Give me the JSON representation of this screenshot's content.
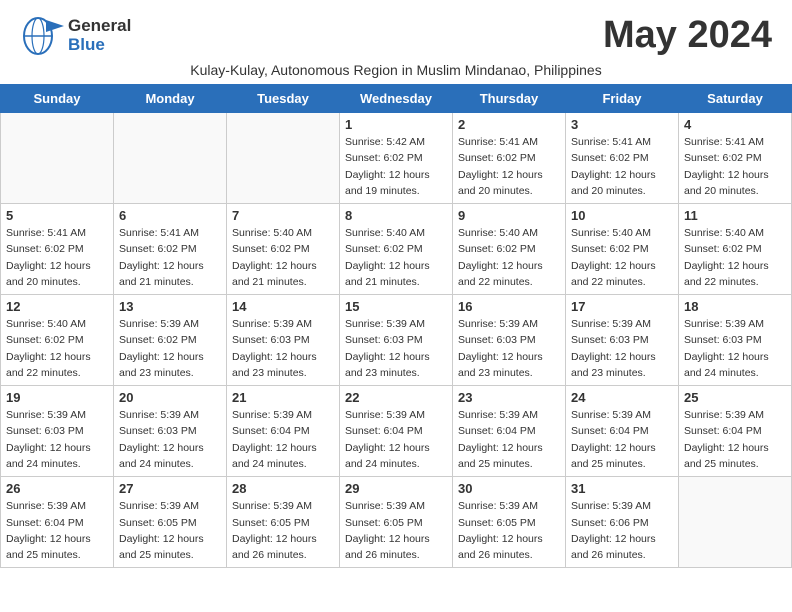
{
  "logo": {
    "general": "General",
    "blue": "Blue"
  },
  "title": "May 2024",
  "subtitle": "Kulay-Kulay, Autonomous Region in Muslim Mindanao, Philippines",
  "days": [
    "Sunday",
    "Monday",
    "Tuesday",
    "Wednesday",
    "Thursday",
    "Friday",
    "Saturday"
  ],
  "weeks": [
    [
      {
        "num": "",
        "info": ""
      },
      {
        "num": "",
        "info": ""
      },
      {
        "num": "",
        "info": ""
      },
      {
        "num": "1",
        "info": "Sunrise: 5:42 AM\nSunset: 6:02 PM\nDaylight: 12 hours\nand 19 minutes."
      },
      {
        "num": "2",
        "info": "Sunrise: 5:41 AM\nSunset: 6:02 PM\nDaylight: 12 hours\nand 20 minutes."
      },
      {
        "num": "3",
        "info": "Sunrise: 5:41 AM\nSunset: 6:02 PM\nDaylight: 12 hours\nand 20 minutes."
      },
      {
        "num": "4",
        "info": "Sunrise: 5:41 AM\nSunset: 6:02 PM\nDaylight: 12 hours\nand 20 minutes."
      }
    ],
    [
      {
        "num": "5",
        "info": "Sunrise: 5:41 AM\nSunset: 6:02 PM\nDaylight: 12 hours\nand 20 minutes."
      },
      {
        "num": "6",
        "info": "Sunrise: 5:41 AM\nSunset: 6:02 PM\nDaylight: 12 hours\nand 21 minutes."
      },
      {
        "num": "7",
        "info": "Sunrise: 5:40 AM\nSunset: 6:02 PM\nDaylight: 12 hours\nand 21 minutes."
      },
      {
        "num": "8",
        "info": "Sunrise: 5:40 AM\nSunset: 6:02 PM\nDaylight: 12 hours\nand 21 minutes."
      },
      {
        "num": "9",
        "info": "Sunrise: 5:40 AM\nSunset: 6:02 PM\nDaylight: 12 hours\nand 22 minutes."
      },
      {
        "num": "10",
        "info": "Sunrise: 5:40 AM\nSunset: 6:02 PM\nDaylight: 12 hours\nand 22 minutes."
      },
      {
        "num": "11",
        "info": "Sunrise: 5:40 AM\nSunset: 6:02 PM\nDaylight: 12 hours\nand 22 minutes."
      }
    ],
    [
      {
        "num": "12",
        "info": "Sunrise: 5:40 AM\nSunset: 6:02 PM\nDaylight: 12 hours\nand 22 minutes."
      },
      {
        "num": "13",
        "info": "Sunrise: 5:39 AM\nSunset: 6:02 PM\nDaylight: 12 hours\nand 23 minutes."
      },
      {
        "num": "14",
        "info": "Sunrise: 5:39 AM\nSunset: 6:03 PM\nDaylight: 12 hours\nand 23 minutes."
      },
      {
        "num": "15",
        "info": "Sunrise: 5:39 AM\nSunset: 6:03 PM\nDaylight: 12 hours\nand 23 minutes."
      },
      {
        "num": "16",
        "info": "Sunrise: 5:39 AM\nSunset: 6:03 PM\nDaylight: 12 hours\nand 23 minutes."
      },
      {
        "num": "17",
        "info": "Sunrise: 5:39 AM\nSunset: 6:03 PM\nDaylight: 12 hours\nand 23 minutes."
      },
      {
        "num": "18",
        "info": "Sunrise: 5:39 AM\nSunset: 6:03 PM\nDaylight: 12 hours\nand 24 minutes."
      }
    ],
    [
      {
        "num": "19",
        "info": "Sunrise: 5:39 AM\nSunset: 6:03 PM\nDaylight: 12 hours\nand 24 minutes."
      },
      {
        "num": "20",
        "info": "Sunrise: 5:39 AM\nSunset: 6:03 PM\nDaylight: 12 hours\nand 24 minutes."
      },
      {
        "num": "21",
        "info": "Sunrise: 5:39 AM\nSunset: 6:04 PM\nDaylight: 12 hours\nand 24 minutes."
      },
      {
        "num": "22",
        "info": "Sunrise: 5:39 AM\nSunset: 6:04 PM\nDaylight: 12 hours\nand 24 minutes."
      },
      {
        "num": "23",
        "info": "Sunrise: 5:39 AM\nSunset: 6:04 PM\nDaylight: 12 hours\nand 25 minutes."
      },
      {
        "num": "24",
        "info": "Sunrise: 5:39 AM\nSunset: 6:04 PM\nDaylight: 12 hours\nand 25 minutes."
      },
      {
        "num": "25",
        "info": "Sunrise: 5:39 AM\nSunset: 6:04 PM\nDaylight: 12 hours\nand 25 minutes."
      }
    ],
    [
      {
        "num": "26",
        "info": "Sunrise: 5:39 AM\nSunset: 6:04 PM\nDaylight: 12 hours\nand 25 minutes."
      },
      {
        "num": "27",
        "info": "Sunrise: 5:39 AM\nSunset: 6:05 PM\nDaylight: 12 hours\nand 25 minutes."
      },
      {
        "num": "28",
        "info": "Sunrise: 5:39 AM\nSunset: 6:05 PM\nDaylight: 12 hours\nand 26 minutes."
      },
      {
        "num": "29",
        "info": "Sunrise: 5:39 AM\nSunset: 6:05 PM\nDaylight: 12 hours\nand 26 minutes."
      },
      {
        "num": "30",
        "info": "Sunrise: 5:39 AM\nSunset: 6:05 PM\nDaylight: 12 hours\nand 26 minutes."
      },
      {
        "num": "31",
        "info": "Sunrise: 5:39 AM\nSunset: 6:06 PM\nDaylight: 12 hours\nand 26 minutes."
      },
      {
        "num": "",
        "info": ""
      }
    ]
  ]
}
